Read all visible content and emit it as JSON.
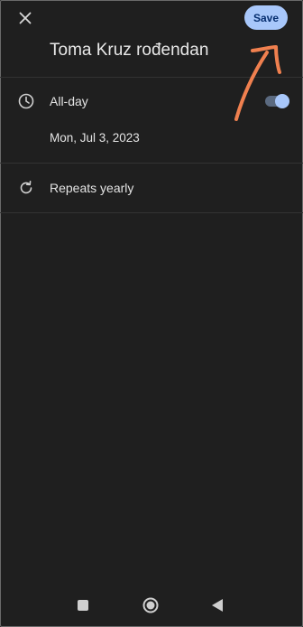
{
  "header": {
    "close_icon": "close-icon",
    "save_label": "Save"
  },
  "event": {
    "title": "Toma Kruz rođendan"
  },
  "all_day": {
    "icon": "clock-icon",
    "label": "All-day",
    "enabled": true,
    "date": "Mon, Jul 3, 2023"
  },
  "repeat": {
    "icon": "repeat-icon",
    "label": "Repeats yearly"
  },
  "annotation": {
    "type": "hand-drawn-arrow",
    "color": "#f0804f"
  },
  "navbar": {
    "items": [
      "recents-icon",
      "home-icon",
      "back-icon"
    ]
  },
  "colors": {
    "background": "#1f1f1f",
    "accent": "#a8c7fa",
    "save_text": "#062e6f",
    "annotation": "#f0804f"
  }
}
